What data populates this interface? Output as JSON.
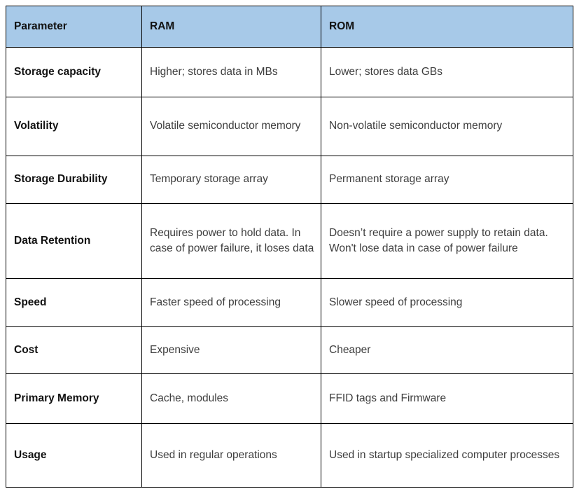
{
  "table": {
    "name": "RAM vs ROM comparison table",
    "header_bg": "#a7c9e8",
    "border_color": "#000000",
    "columns": [
      {
        "key": "parameter",
        "label": "Parameter"
      },
      {
        "key": "ram",
        "label": "RAM"
      },
      {
        "key": "rom",
        "label": "ROM"
      }
    ],
    "rows": [
      {
        "parameter": "Storage capacity",
        "ram": "Higher; stores data in MBs",
        "rom": "Lower; stores data GBs"
      },
      {
        "parameter": "Volatility",
        "ram": "Volatile semiconductor memory",
        "rom": "Non-volatile semiconductor memory"
      },
      {
        "parameter": "Storage Durability",
        "ram": "Temporary storage array",
        "rom": "Permanent storage array"
      },
      {
        "parameter": "Data Retention",
        "ram": "Requires power to hold data. In case of power failure, it loses data",
        "rom": "Doesn’t require a power supply to retain data. Won't lose data in case of power failure"
      },
      {
        "parameter": "Speed",
        "ram": "Faster speed of processing",
        "rom": "Slower speed of processing"
      },
      {
        "parameter": "Cost",
        "ram": "Expensive",
        "rom": "Cheaper"
      },
      {
        "parameter": "Primary Memory",
        "ram": "Cache, modules",
        "rom": "FFID tags and Firmware"
      },
      {
        "parameter": "Usage",
        "ram": "Used in regular operations",
        "rom": "Used in startup specialized computer processes"
      }
    ]
  }
}
